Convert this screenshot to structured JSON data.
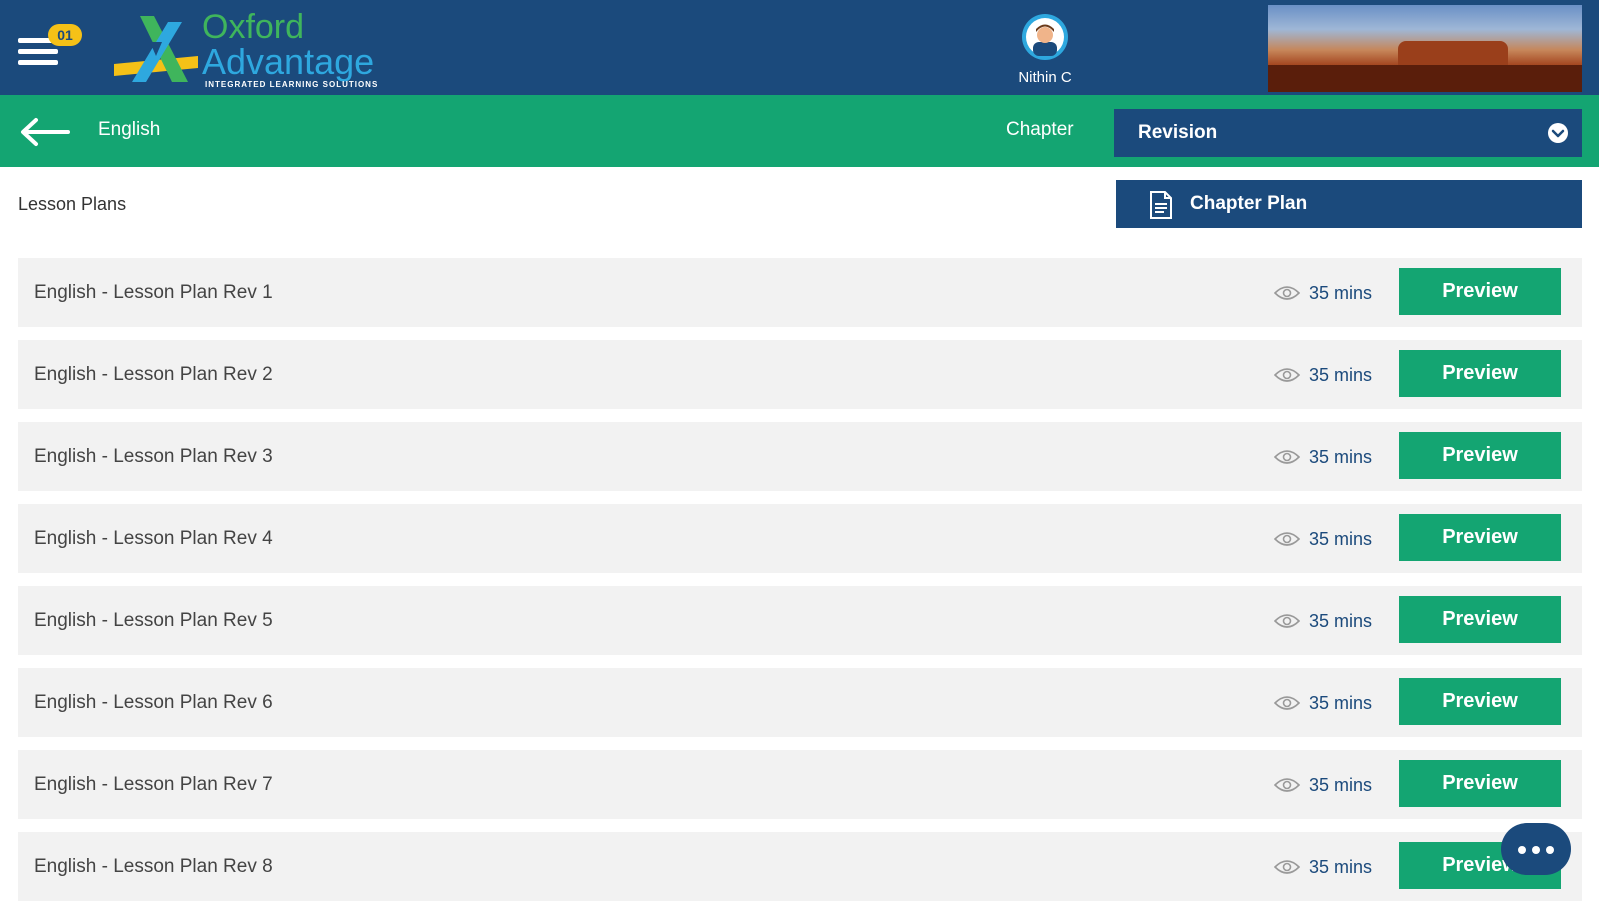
{
  "header": {
    "notification_count": "01",
    "logo": {
      "line1": "Oxford",
      "line2": "Advantage",
      "tagline": "INTEGRATED LEARNING SOLUTIONS"
    },
    "user_name": "Nithin C"
  },
  "subheader": {
    "breadcrumb": "English",
    "chapter_label": "Chapter",
    "chapter_selected": "Revision"
  },
  "main": {
    "section_title": "Lesson Plans",
    "chapter_plan_label": "Chapter Plan",
    "lesson_plans": [
      {
        "title": "English - Lesson Plan Rev 1",
        "duration": "35 mins",
        "action": "Preview"
      },
      {
        "title": "English - Lesson Plan Rev 2",
        "duration": "35 mins",
        "action": "Preview"
      },
      {
        "title": "English - Lesson Plan Rev 3",
        "duration": "35 mins",
        "action": "Preview"
      },
      {
        "title": "English - Lesson Plan Rev 4",
        "duration": "35 mins",
        "action": "Preview"
      },
      {
        "title": "English - Lesson Plan Rev 5",
        "duration": "35 mins",
        "action": "Preview"
      },
      {
        "title": "English - Lesson Plan Rev 6",
        "duration": "35 mins",
        "action": "Preview"
      },
      {
        "title": "English - Lesson Plan Rev 7",
        "duration": "35 mins",
        "action": "Preview"
      },
      {
        "title": "English - Lesson Plan Rev 8",
        "duration": "35 mins",
        "action": "Preview"
      }
    ]
  },
  "icons": {
    "menu": "hamburger-icon",
    "back": "arrow-left-icon",
    "dropdown": "chevron-down-icon",
    "chapter_plan": "document-icon",
    "duration": "eye-icon",
    "fab": "more-dots-icon"
  },
  "colors": {
    "header_bg": "#1b4a7c",
    "accent_green": "#14a572",
    "badge": "#f5c117",
    "row_bg": "#f2f2f2"
  }
}
